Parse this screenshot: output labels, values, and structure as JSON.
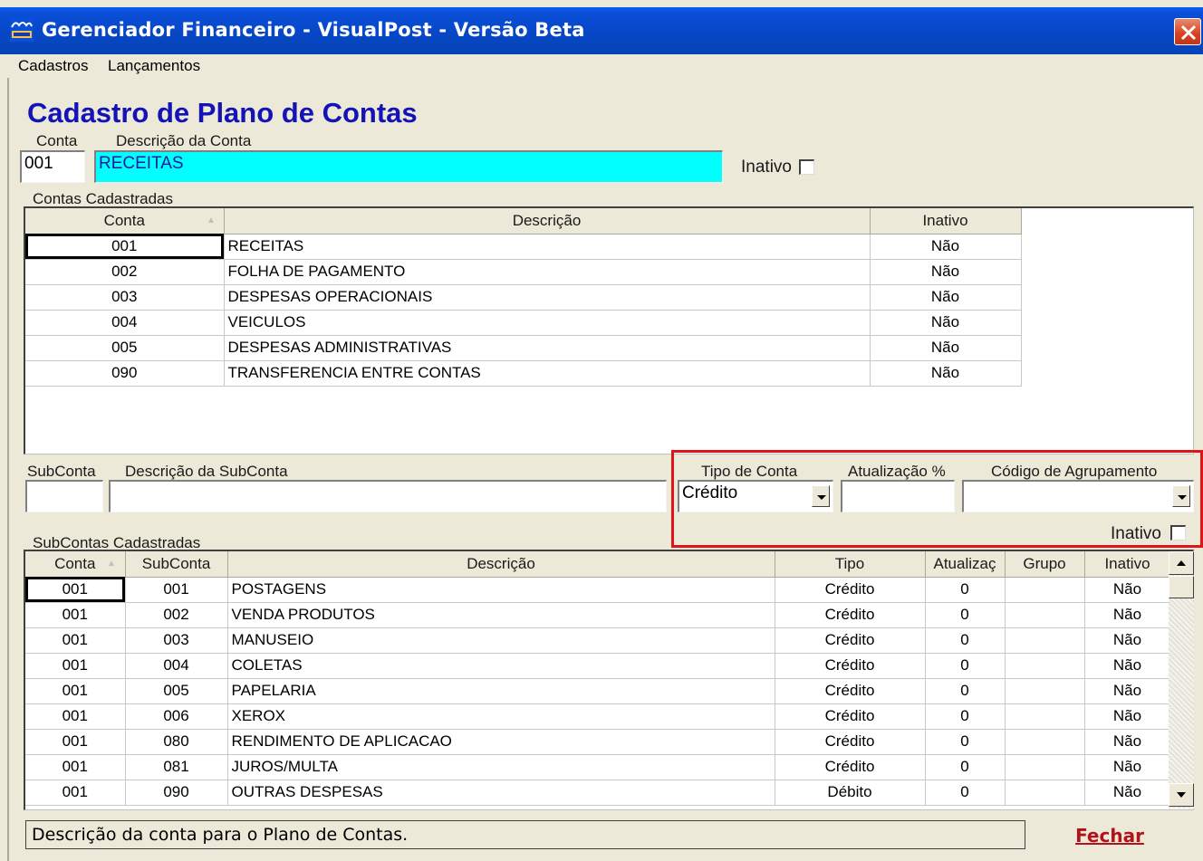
{
  "window": {
    "title": "Gerenciador Financeiro - VisualPost - Versão Beta",
    "icon": "app-logo-icon"
  },
  "menu": [
    "Cadastros",
    "Lançamentos"
  ],
  "form": {
    "heading": "Cadastro de Plano de Contas",
    "conta_label": "Conta",
    "conta_value": "001",
    "descricao_label": "Descrição da Conta",
    "descricao_value": "RECEITAS",
    "inativo_label": "Inativo",
    "contas_cadastradas_label": "Contas Cadastradas"
  },
  "contas_grid": {
    "columns": [
      "Conta",
      "Descrição",
      "Inativo"
    ],
    "rows": [
      [
        "001",
        "RECEITAS",
        "Não"
      ],
      [
        "002",
        "FOLHA DE PAGAMENTO",
        "Não"
      ],
      [
        "003",
        "DESPESAS OPERACIONAIS",
        "Não"
      ],
      [
        "004",
        "VEICULOS",
        "Não"
      ],
      [
        "005",
        "DESPESAS ADMINISTRATIVAS",
        "Não"
      ],
      [
        "090",
        "TRANSFERENCIA ENTRE CONTAS",
        "Não"
      ]
    ]
  },
  "subconta_form": {
    "subconta_label": "SubConta",
    "subconta_value": "",
    "descricao_label": "Descrição da SubConta",
    "descricao_value": "",
    "tipo_label": "Tipo de Conta",
    "tipo_value": "Crédito",
    "atualizacao_label": "Atualização %",
    "atualizacao_value": "",
    "agrupamento_label": "Código de Agrupamento",
    "agrupamento_value": "",
    "inativo_label": "Inativo",
    "subcontas_cadastradas_label": "SubContas Cadastradas"
  },
  "subcontas_grid": {
    "columns": [
      "Conta",
      "SubConta",
      "Descrição",
      "Tipo",
      "Atualizaç",
      "Grupo",
      "Inativo"
    ],
    "rows": [
      [
        "001",
        "001",
        "POSTAGENS",
        "Crédito",
        "0",
        "",
        "Não"
      ],
      [
        "001",
        "002",
        "VENDA PRODUTOS",
        "Crédito",
        "0",
        "",
        "Não"
      ],
      [
        "001",
        "003",
        "MANUSEIO",
        "Crédito",
        "0",
        "",
        "Não"
      ],
      [
        "001",
        "004",
        "COLETAS",
        "Crédito",
        "0",
        "",
        "Não"
      ],
      [
        "001",
        "005",
        "PAPELARIA",
        "Crédito",
        "0",
        "",
        "Não"
      ],
      [
        "001",
        "006",
        "XEROX",
        "Crédito",
        "0",
        "",
        "Não"
      ],
      [
        "001",
        "080",
        "RENDIMENTO DE APLICACAO",
        "Crédito",
        "0",
        "",
        "Não"
      ],
      [
        "001",
        "081",
        "JUROS/MULTA",
        "Crédito",
        "0",
        "",
        "Não"
      ],
      [
        "001",
        "090",
        "OUTRAS DESPESAS",
        "Débito",
        "0",
        "",
        "Não"
      ]
    ]
  },
  "status": {
    "message": "Descrição da conta para o Plano de Contas.",
    "close_label": "Fechar"
  },
  "colors": {
    "titlebar": "#0747c6",
    "heading": "#1313b8",
    "description_field": "#00ffff",
    "highlight": "#e0151a",
    "close_text": "#b3121a"
  }
}
